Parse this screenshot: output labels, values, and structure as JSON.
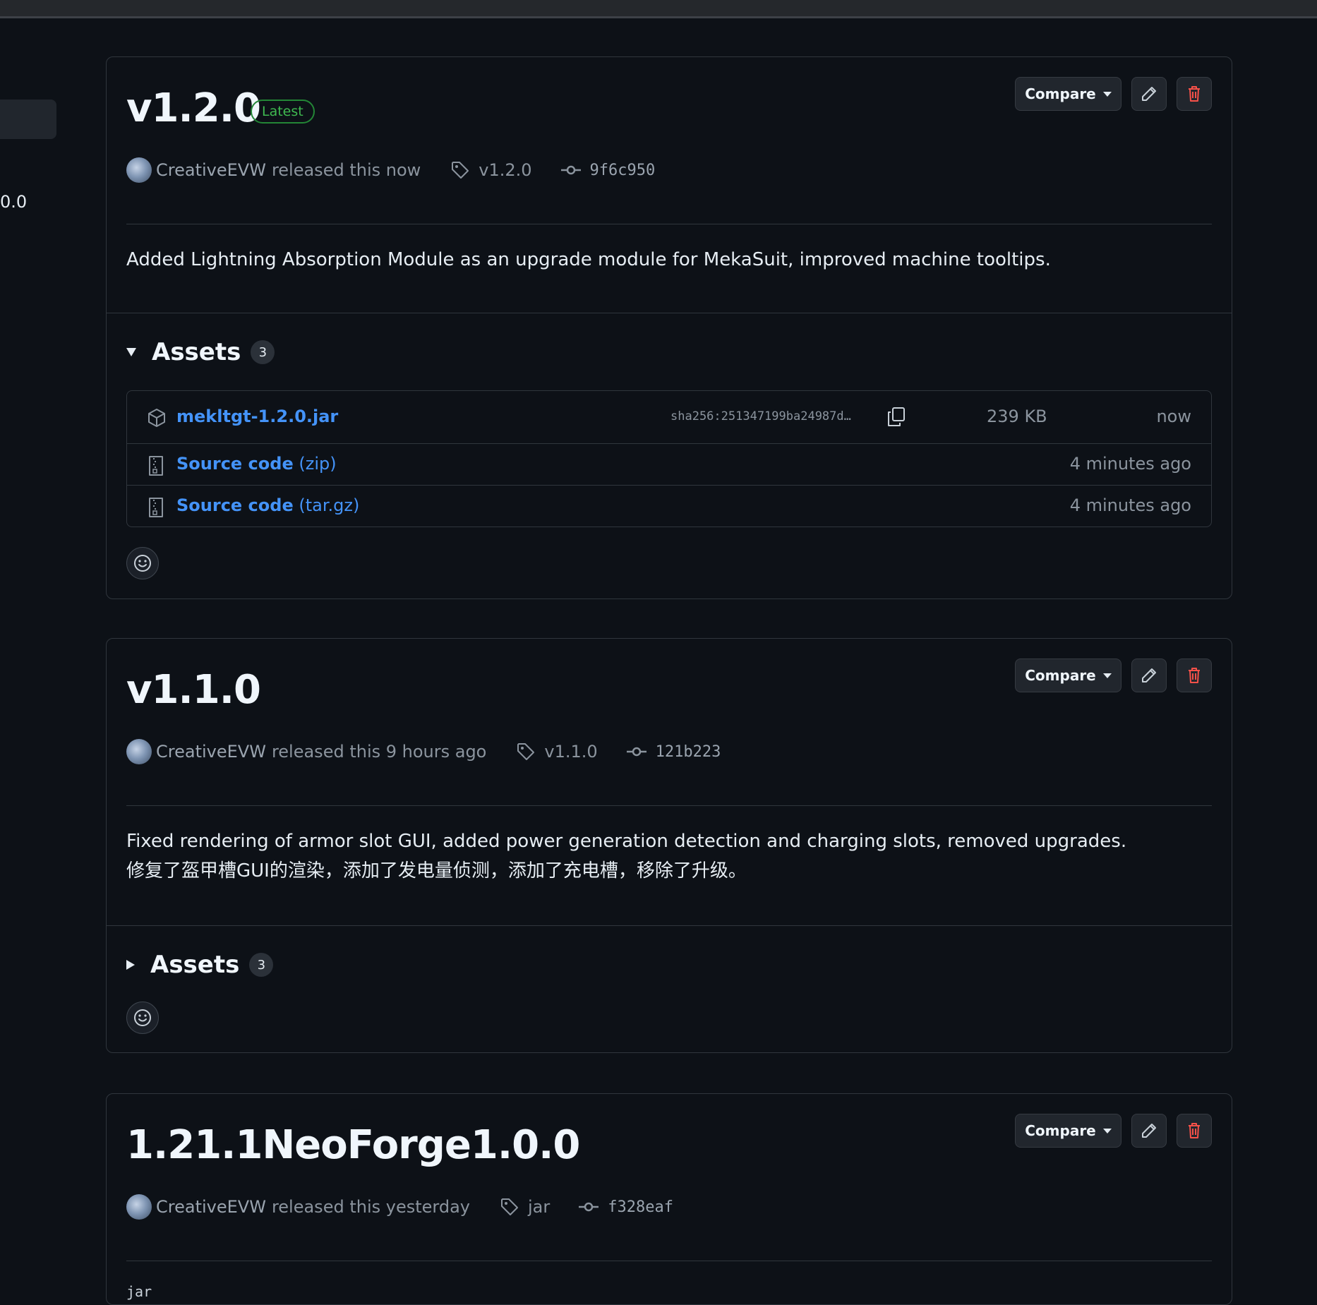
{
  "sidebar": {
    "partial_text": "0.0"
  },
  "releases": [
    {
      "title": "v1.2.0",
      "latest_badge": "Latest",
      "compare_label": "Compare",
      "author": "CreativeEVW",
      "released_text": "released this now",
      "tag": "v1.2.0",
      "commit": "9f6c950",
      "body": [
        "Added Lightning Absorption Module as an upgrade module for MekaSuit, improved machine tooltips."
      ],
      "assets_label": "Assets",
      "assets_count": "3",
      "assets_expanded": true,
      "assets": [
        {
          "name": "mekltgt-1.2.0.jar",
          "sha": "sha256:251347199ba24987d…",
          "size": "239 KB",
          "time": "now",
          "icon": "package-icon"
        },
        {
          "name": "Source code",
          "ext": "(zip)",
          "time": "4 minutes ago",
          "icon": "file-zip-icon"
        },
        {
          "name": "Source code",
          "ext": "(tar.gz)",
          "time": "4 minutes ago",
          "icon": "file-zip-icon"
        }
      ]
    },
    {
      "title": "v1.1.0",
      "compare_label": "Compare",
      "author": "CreativeEVW",
      "released_text": "released this 9 hours ago",
      "tag": "v1.1.0",
      "commit": "121b223",
      "body": [
        "Fixed rendering of armor slot GUI, added power generation detection and charging slots, removed upgrades.",
        "修复了盔甲槽GUI的渲染，添加了发电量侦测，添加了充电槽，移除了升级。"
      ],
      "assets_label": "Assets",
      "assets_count": "3",
      "assets_expanded": false
    },
    {
      "title": "1.21.1NeoForge1.0.0",
      "compare_label": "Compare",
      "author": "CreativeEVW",
      "released_text": "released this yesterday",
      "tag": "jar",
      "commit": "f328eaf",
      "body": [
        "jar"
      ]
    }
  ]
}
